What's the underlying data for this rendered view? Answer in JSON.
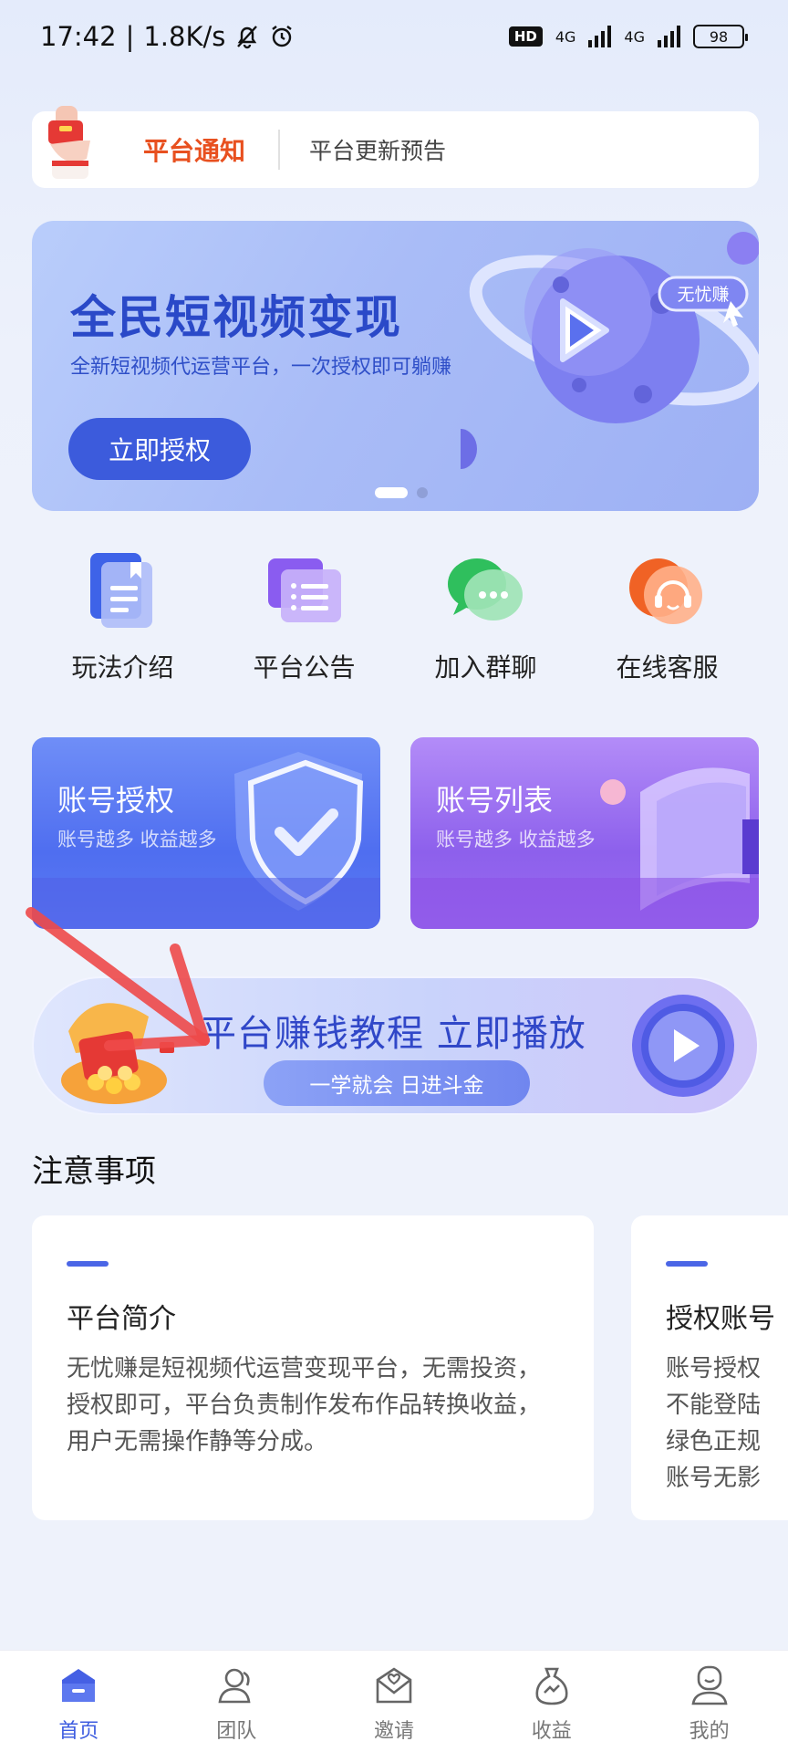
{
  "status_bar": {
    "time": "17:42",
    "speed": "1.8K/s",
    "hd": "HD",
    "net1": "4G",
    "net2": "4G",
    "battery": "98"
  },
  "notice": {
    "title": "平台通知",
    "text": "平台更新预告"
  },
  "banner": {
    "title": "全民短视频变现",
    "subtitle": "全新短视频代运营平台，一次授权即可躺赚",
    "button": "立即授权",
    "badge": "无忧赚"
  },
  "quick_entries": [
    {
      "label": "玩法介绍",
      "icon": "document-icon"
    },
    {
      "label": "平台公告",
      "icon": "announcement-icon"
    },
    {
      "label": "加入群聊",
      "icon": "wechat-icon"
    },
    {
      "label": "在线客服",
      "icon": "headset-icon"
    }
  ],
  "cards": {
    "auth": {
      "title": "账号授权",
      "subtitle": "账号越多 收益越多"
    },
    "list": {
      "title": "账号列表",
      "subtitle": "账号越多 收益越多"
    }
  },
  "tutorial": {
    "title": "平台赚钱教程 立即播放",
    "subtitle": "一学就会 日进斗金"
  },
  "notes": {
    "section_title": "注意事项",
    "items": [
      {
        "title": "平台简介",
        "body": "无忧赚是短视频代运营变现平台，无需投资，授权即可，平台负责制作发布作品转换收益，用户无需操作静等分成。"
      },
      {
        "title": "授权账号",
        "lines": [
          "账号授权",
          "不能登陆",
          "绿色正规",
          "账号无影"
        ]
      }
    ]
  },
  "tabs": [
    {
      "label": "首页",
      "icon": "home-icon",
      "active": true
    },
    {
      "label": "团队",
      "icon": "team-icon"
    },
    {
      "label": "邀请",
      "icon": "invite-icon"
    },
    {
      "label": "收益",
      "icon": "earnings-icon"
    },
    {
      "label": "我的",
      "icon": "profile-icon"
    }
  ],
  "colors": {
    "accent": "#3f5ee0",
    "notice_red": "#e8501f"
  }
}
